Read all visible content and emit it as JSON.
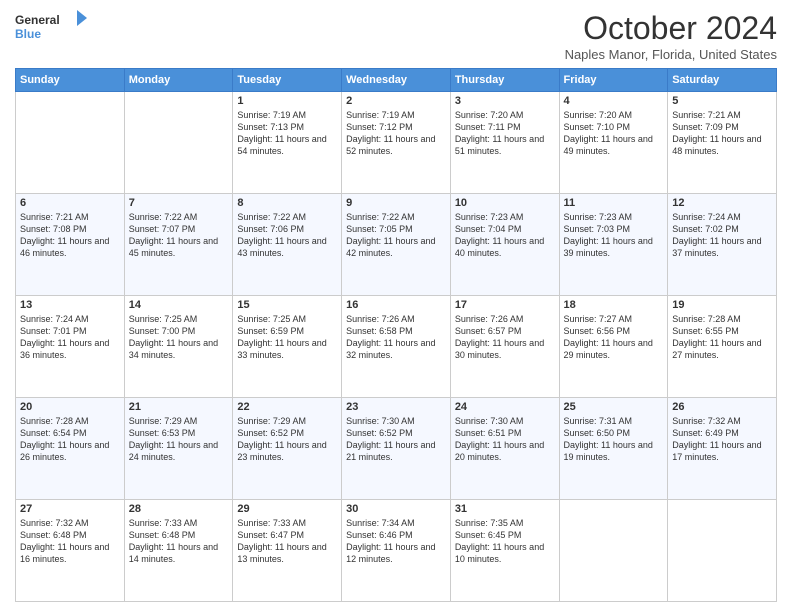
{
  "header": {
    "logo_general": "General",
    "logo_blue": "Blue",
    "title": "October 2024",
    "location": "Naples Manor, Florida, United States"
  },
  "columns": [
    "Sunday",
    "Monday",
    "Tuesday",
    "Wednesday",
    "Thursday",
    "Friday",
    "Saturday"
  ],
  "weeks": [
    [
      {
        "day": "",
        "sunrise": "",
        "sunset": "",
        "daylight": ""
      },
      {
        "day": "",
        "sunrise": "",
        "sunset": "",
        "daylight": ""
      },
      {
        "day": "1",
        "sunrise": "Sunrise: 7:19 AM",
        "sunset": "Sunset: 7:13 PM",
        "daylight": "Daylight: 11 hours and 54 minutes."
      },
      {
        "day": "2",
        "sunrise": "Sunrise: 7:19 AM",
        "sunset": "Sunset: 7:12 PM",
        "daylight": "Daylight: 11 hours and 52 minutes."
      },
      {
        "day": "3",
        "sunrise": "Sunrise: 7:20 AM",
        "sunset": "Sunset: 7:11 PM",
        "daylight": "Daylight: 11 hours and 51 minutes."
      },
      {
        "day": "4",
        "sunrise": "Sunrise: 7:20 AM",
        "sunset": "Sunset: 7:10 PM",
        "daylight": "Daylight: 11 hours and 49 minutes."
      },
      {
        "day": "5",
        "sunrise": "Sunrise: 7:21 AM",
        "sunset": "Sunset: 7:09 PM",
        "daylight": "Daylight: 11 hours and 48 minutes."
      }
    ],
    [
      {
        "day": "6",
        "sunrise": "Sunrise: 7:21 AM",
        "sunset": "Sunset: 7:08 PM",
        "daylight": "Daylight: 11 hours and 46 minutes."
      },
      {
        "day": "7",
        "sunrise": "Sunrise: 7:22 AM",
        "sunset": "Sunset: 7:07 PM",
        "daylight": "Daylight: 11 hours and 45 minutes."
      },
      {
        "day": "8",
        "sunrise": "Sunrise: 7:22 AM",
        "sunset": "Sunset: 7:06 PM",
        "daylight": "Daylight: 11 hours and 43 minutes."
      },
      {
        "day": "9",
        "sunrise": "Sunrise: 7:22 AM",
        "sunset": "Sunset: 7:05 PM",
        "daylight": "Daylight: 11 hours and 42 minutes."
      },
      {
        "day": "10",
        "sunrise": "Sunrise: 7:23 AM",
        "sunset": "Sunset: 7:04 PM",
        "daylight": "Daylight: 11 hours and 40 minutes."
      },
      {
        "day": "11",
        "sunrise": "Sunrise: 7:23 AM",
        "sunset": "Sunset: 7:03 PM",
        "daylight": "Daylight: 11 hours and 39 minutes."
      },
      {
        "day": "12",
        "sunrise": "Sunrise: 7:24 AM",
        "sunset": "Sunset: 7:02 PM",
        "daylight": "Daylight: 11 hours and 37 minutes."
      }
    ],
    [
      {
        "day": "13",
        "sunrise": "Sunrise: 7:24 AM",
        "sunset": "Sunset: 7:01 PM",
        "daylight": "Daylight: 11 hours and 36 minutes."
      },
      {
        "day": "14",
        "sunrise": "Sunrise: 7:25 AM",
        "sunset": "Sunset: 7:00 PM",
        "daylight": "Daylight: 11 hours and 34 minutes."
      },
      {
        "day": "15",
        "sunrise": "Sunrise: 7:25 AM",
        "sunset": "Sunset: 6:59 PM",
        "daylight": "Daylight: 11 hours and 33 minutes."
      },
      {
        "day": "16",
        "sunrise": "Sunrise: 7:26 AM",
        "sunset": "Sunset: 6:58 PM",
        "daylight": "Daylight: 11 hours and 32 minutes."
      },
      {
        "day": "17",
        "sunrise": "Sunrise: 7:26 AM",
        "sunset": "Sunset: 6:57 PM",
        "daylight": "Daylight: 11 hours and 30 minutes."
      },
      {
        "day": "18",
        "sunrise": "Sunrise: 7:27 AM",
        "sunset": "Sunset: 6:56 PM",
        "daylight": "Daylight: 11 hours and 29 minutes."
      },
      {
        "day": "19",
        "sunrise": "Sunrise: 7:28 AM",
        "sunset": "Sunset: 6:55 PM",
        "daylight": "Daylight: 11 hours and 27 minutes."
      }
    ],
    [
      {
        "day": "20",
        "sunrise": "Sunrise: 7:28 AM",
        "sunset": "Sunset: 6:54 PM",
        "daylight": "Daylight: 11 hours and 26 minutes."
      },
      {
        "day": "21",
        "sunrise": "Sunrise: 7:29 AM",
        "sunset": "Sunset: 6:53 PM",
        "daylight": "Daylight: 11 hours and 24 minutes."
      },
      {
        "day": "22",
        "sunrise": "Sunrise: 7:29 AM",
        "sunset": "Sunset: 6:52 PM",
        "daylight": "Daylight: 11 hours and 23 minutes."
      },
      {
        "day": "23",
        "sunrise": "Sunrise: 7:30 AM",
        "sunset": "Sunset: 6:52 PM",
        "daylight": "Daylight: 11 hours and 21 minutes."
      },
      {
        "day": "24",
        "sunrise": "Sunrise: 7:30 AM",
        "sunset": "Sunset: 6:51 PM",
        "daylight": "Daylight: 11 hours and 20 minutes."
      },
      {
        "day": "25",
        "sunrise": "Sunrise: 7:31 AM",
        "sunset": "Sunset: 6:50 PM",
        "daylight": "Daylight: 11 hours and 19 minutes."
      },
      {
        "day": "26",
        "sunrise": "Sunrise: 7:32 AM",
        "sunset": "Sunset: 6:49 PM",
        "daylight": "Daylight: 11 hours and 17 minutes."
      }
    ],
    [
      {
        "day": "27",
        "sunrise": "Sunrise: 7:32 AM",
        "sunset": "Sunset: 6:48 PM",
        "daylight": "Daylight: 11 hours and 16 minutes."
      },
      {
        "day": "28",
        "sunrise": "Sunrise: 7:33 AM",
        "sunset": "Sunset: 6:48 PM",
        "daylight": "Daylight: 11 hours and 14 minutes."
      },
      {
        "day": "29",
        "sunrise": "Sunrise: 7:33 AM",
        "sunset": "Sunset: 6:47 PM",
        "daylight": "Daylight: 11 hours and 13 minutes."
      },
      {
        "day": "30",
        "sunrise": "Sunrise: 7:34 AM",
        "sunset": "Sunset: 6:46 PM",
        "daylight": "Daylight: 11 hours and 12 minutes."
      },
      {
        "day": "31",
        "sunrise": "Sunrise: 7:35 AM",
        "sunset": "Sunset: 6:45 PM",
        "daylight": "Daylight: 11 hours and 10 minutes."
      },
      {
        "day": "",
        "sunrise": "",
        "sunset": "",
        "daylight": ""
      },
      {
        "day": "",
        "sunrise": "",
        "sunset": "",
        "daylight": ""
      }
    ]
  ]
}
